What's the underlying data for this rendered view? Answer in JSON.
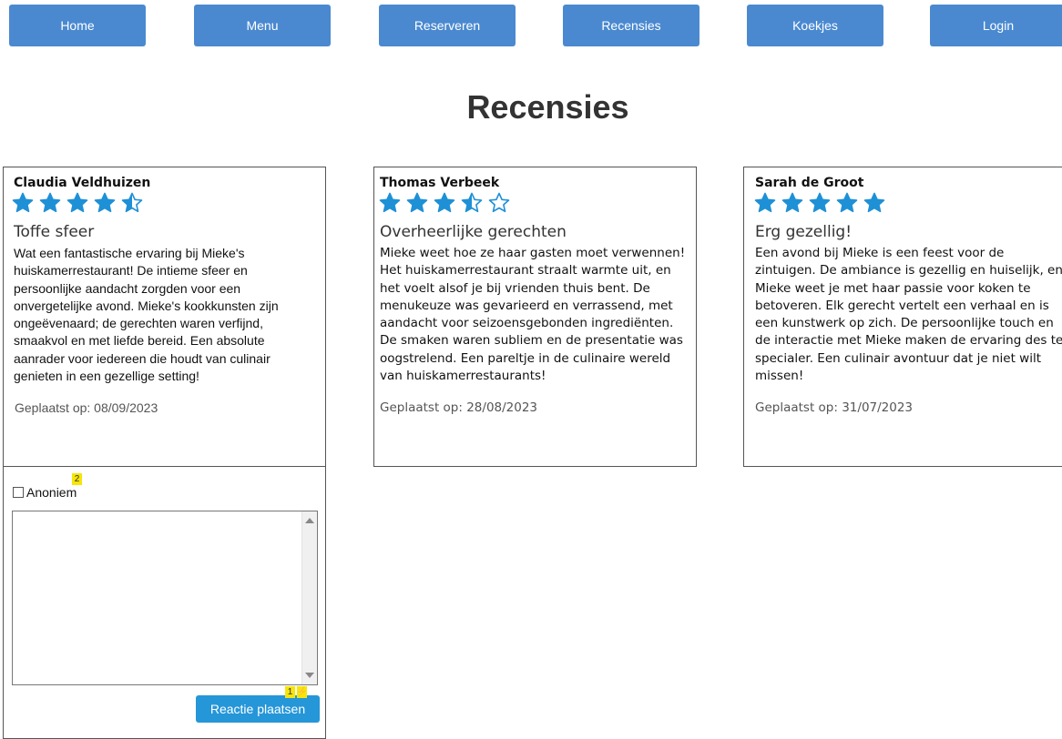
{
  "nav": {
    "items": [
      "Home",
      "Menu",
      "Reserveren",
      "Recensies",
      "Koekjes",
      "Login"
    ]
  },
  "page": {
    "title": "Recensies"
  },
  "reviews": [
    {
      "author": "Claudia Veldhuizen",
      "rating": 4.5,
      "title": "Toffe sfeer",
      "body": "Wat een fantastische ervaring bij Mieke's huiskamerrestaurant! De intieme sfeer en persoonlijke aandacht zorgden voor een onvergetelijke avond. Mieke's kookkunsten zijn ongeëvenaard; de gerechten waren verfijnd, smaakvol en met liefde bereid. Een absolute aanrader voor iedereen die houdt van culinair genieten in een gezellige setting!",
      "date": "Geplaatst op: 08/09/2023"
    },
    {
      "author": "Thomas Verbeek",
      "rating": 3.5,
      "title": "Overheerlijke gerechten",
      "body": "Mieke weet hoe ze haar gasten moet verwennen! Het huiskamerrestaurant straalt warmte uit, en het voelt alsof je bij vrienden thuis bent. De menukeuze was gevarieerd en verrassend, met aandacht voor seizoensgebonden ingrediënten. De smaken waren subliem en de presentatie was oogstrelend. Een pareltje in de culinaire wereld van huiskamerrestaurants!",
      "date": "Geplaatst op: 28/08/2023"
    },
    {
      "author": "Sarah de Groot",
      "rating": 5,
      "title": "Erg gezellig!",
      "body": "Een avond bij Mieke is een feest voor de zintuigen. De ambiance is gezellig en huiselijk, en Mieke weet je met haar passie voor koken te betoveren. Elk gerecht vertelt een verhaal en is een kunstwerk op zich. De persoonlijke touch en de interactie met Mieke maken de ervaring des te specialer. Een culinair avontuur dat je niet wilt missen!",
      "date": "Geplaatst op: 31/07/2023"
    }
  ],
  "comment_form": {
    "anonymous_label": "Anoniem",
    "anonymous_checked": false,
    "textarea_value": "",
    "submit_label": "Reactie plaatsen"
  },
  "markers": {
    "m1": "1",
    "m2": "2",
    "m3": "⚡"
  },
  "colors": {
    "nav": "#4a89d0",
    "star": "#1e90d6",
    "submit": "#2596d8",
    "marker": "#f6e50a"
  }
}
